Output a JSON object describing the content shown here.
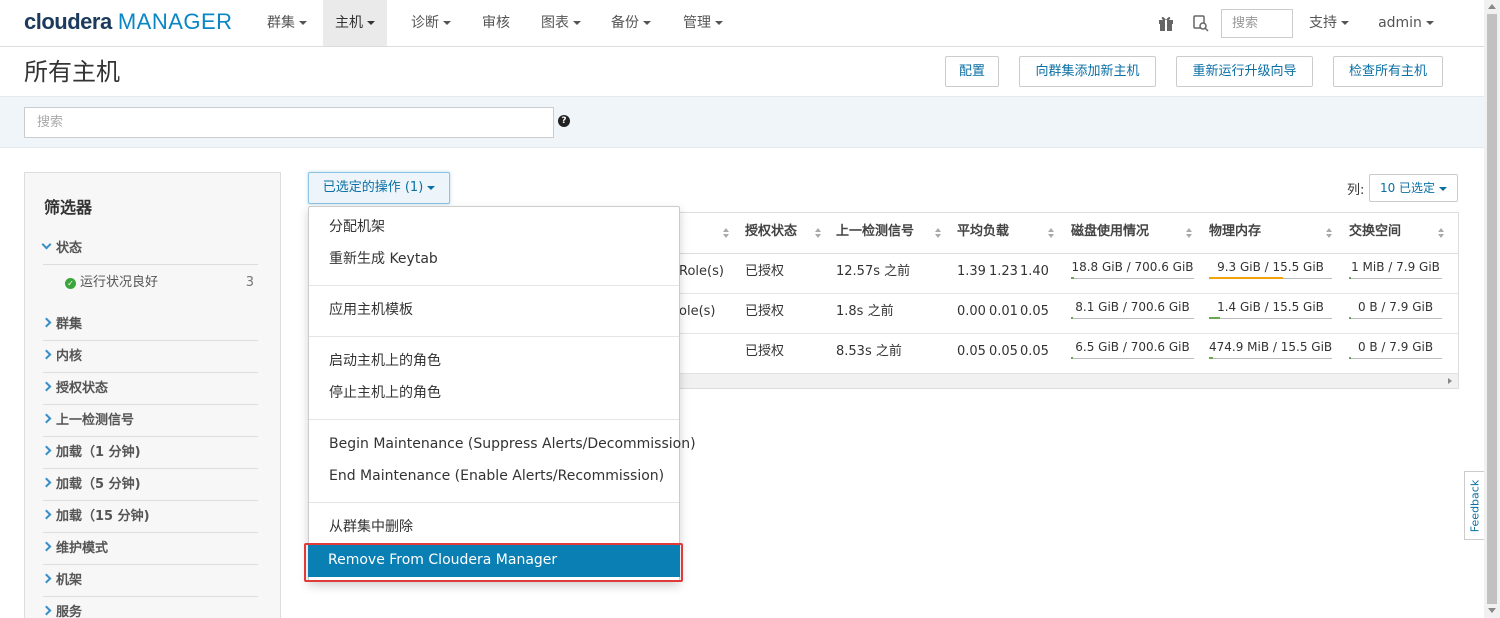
{
  "navbar": {
    "logo_brand": "cloudera",
    "logo_product": "MANAGER",
    "menus": [
      "群集",
      "主机",
      "诊断",
      "审核",
      "图表",
      "备份",
      "管理"
    ],
    "search_placeholder": "搜索",
    "support_label": "支持",
    "user_label": "admin"
  },
  "page": {
    "title": "所有主机",
    "buttons": [
      "配置",
      "向群集添加新主机",
      "重新运行升级向导",
      "检查所有主机"
    ],
    "search_placeholder": "搜索",
    "help_glyph": "?"
  },
  "filters": {
    "title": "筛选器",
    "sections": [
      "状态",
      "群集",
      "内核",
      "授权状态",
      "上一检测信号",
      "加载（1 分钟)",
      "加载（5 分钟)",
      "加载（15 分钟)",
      "维护模式",
      "机架",
      "服务"
    ],
    "status_option": {
      "label": "运行状况良好",
      "count": "3"
    }
  },
  "actions": {
    "label": "已选定的操作 (1)",
    "menu_items": [
      "分配机架",
      "重新生成 Keytab",
      "应用主机模板",
      "启动主机上的角色",
      "停止主机上的角色",
      "Begin Maintenance (Suppress Alerts/Decommission)",
      "End Maintenance (Enable Alerts/Recommission)",
      "从群集中删除",
      "Remove From Cloudera Manager"
    ]
  },
  "columns": {
    "label": "列:",
    "selector": "10 已选定"
  },
  "table": {
    "headers": [
      "授权状态",
      "上一检测信号",
      "平均负载",
      "磁盘使用情况",
      "物理内存",
      "交换空间"
    ],
    "rows": [
      {
        "roles": "Role(s)",
        "auth": "已授权",
        "heartbeat": "12.57s 之前",
        "load": [
          "1.39",
          "1.23",
          "1.40"
        ],
        "disk": "18.8 GiB / 700.6 GiB",
        "disk_pct": 0.027,
        "mem": "9.3 GiB / 15.5 GiB",
        "mem_pct": 0.6,
        "swap": "1 MiB / 7.9 GiB",
        "swap_pct": 0.0
      },
      {
        "roles": "ole(s)",
        "auth": "已授权",
        "heartbeat": "1.8s 之前",
        "load": [
          "0.00",
          "0.01",
          "0.05"
        ],
        "disk": "8.1 GiB / 700.6 GiB",
        "disk_pct": 0.012,
        "mem": "1.4 GiB / 15.5 GiB",
        "mem_pct": 0.09,
        "swap": "0 B / 7.9 GiB",
        "swap_pct": 0.0
      },
      {
        "roles": "",
        "auth": "已授权",
        "heartbeat": "8.53s 之前",
        "load": [
          "0.05",
          "0.05",
          "0.05"
        ],
        "disk": "6.5 GiB / 700.6 GiB",
        "disk_pct": 0.009,
        "mem": "474.9 MiB / 15.5 GiB",
        "mem_pct": 0.03,
        "swap": "0 B / 7.9 GiB",
        "swap_pct": 0.0
      }
    ]
  },
  "feedback_label": "Feedback",
  "colors": {
    "accent": "#0a7fb3",
    "brand_dark": "#1b3a5c",
    "ok": "#3aa63a",
    "mem_bar": "#f0a30a",
    "disk_bar": "#6aa84f",
    "highlight": "#e03a3a"
  },
  "icons": [
    "gift-icon",
    "user-search-icon",
    "caret-down-icon",
    "question-icon",
    "check-circle-icon",
    "chevron-right-icon",
    "chevron-down-icon",
    "sort-icon"
  ]
}
